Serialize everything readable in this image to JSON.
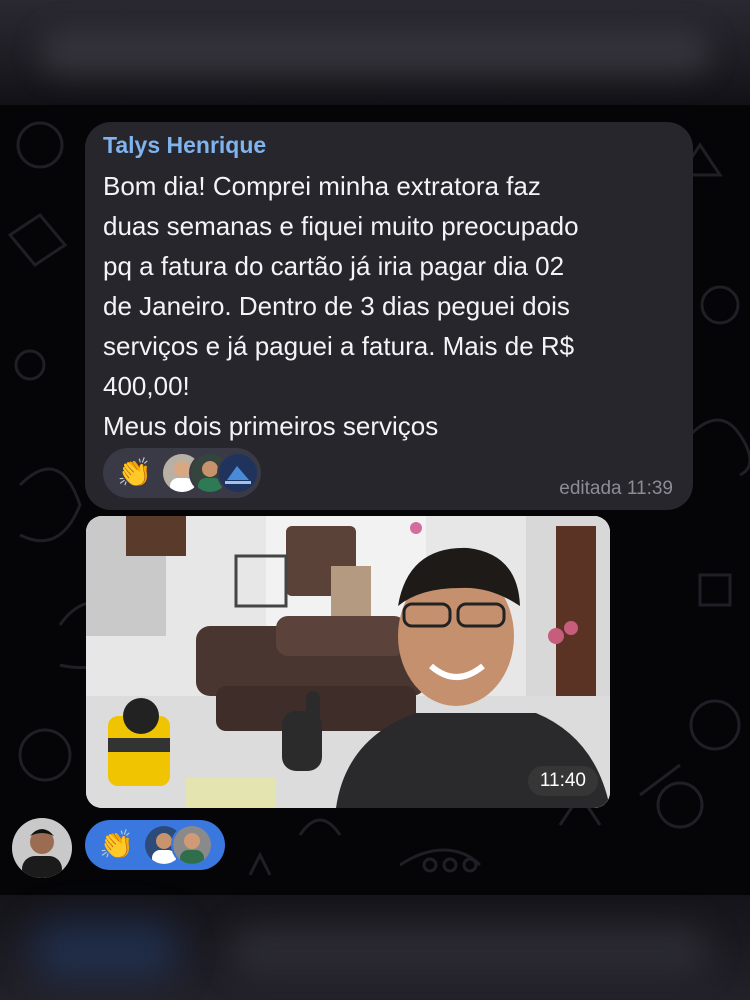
{
  "message": {
    "sender": "Talys Henrique",
    "lines": [
      "Bom dia! Comprei minha extratora faz",
      "duas semanas e fiquei muito preocupado",
      "pq a fatura do cartão já iria pagar dia 02",
      "de Janeiro. Dentro de 3 dias peguei dois",
      "serviços e já paguei a fatura. Mais de R$",
      "400,00!",
      "Meus dois primeiros serviços"
    ],
    "trailing_emoji": [
      "💪🏻",
      "💪🏻",
      "💪🏻",
      "💪🏻"
    ],
    "reaction_emoji": "👏",
    "edited_label": "editada 11:39"
  },
  "photo_message": {
    "time": "11:40"
  },
  "own_reaction": {
    "emoji": "👏"
  },
  "colors": {
    "sender": "#7fb4ee",
    "bubble": "#27262d",
    "own_reaction": "#3a78e0"
  },
  "icons": [
    "clapping-hands-emoji",
    "flexed-biceps-emoji"
  ]
}
